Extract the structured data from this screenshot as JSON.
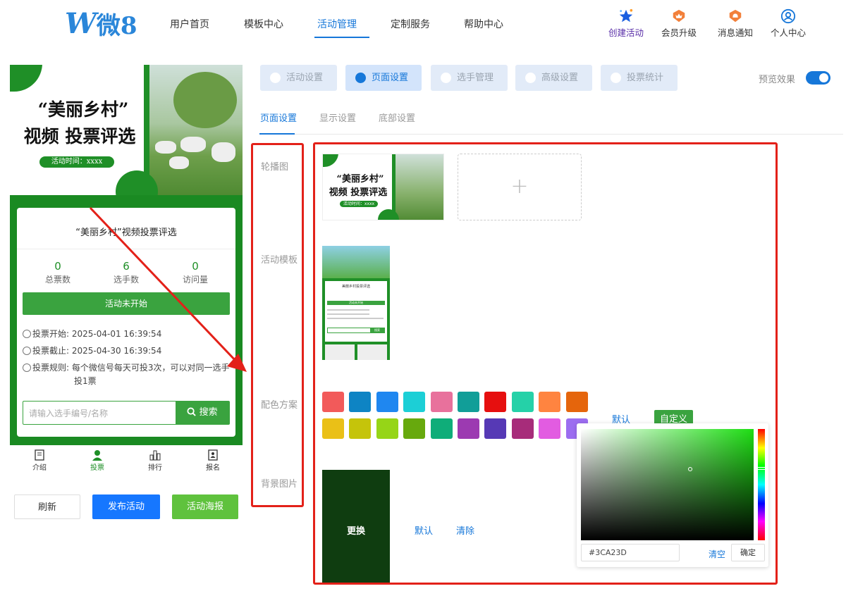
{
  "header": {
    "logo_letter": "W",
    "logo_text": "微8",
    "nav": [
      "用户首页",
      "模板中心",
      "活动管理",
      "定制服务",
      "帮助中心"
    ],
    "active_nav": "活动管理",
    "actions": [
      {
        "label": "创建活动",
        "icon": "star-icon"
      },
      {
        "label": "会员升级",
        "icon": "crown-badge-icon"
      },
      {
        "label": "消息通知",
        "icon": "bell-badge-icon"
      },
      {
        "label": "个人中心",
        "icon": "user-icon"
      }
    ],
    "accent": "#1677d9"
  },
  "preview": {
    "banner_title_line1": "“美丽乡村”",
    "banner_title_line2": "视频 投票评选",
    "banner_time": "活动时间：xxxx",
    "card_title": "“美丽乡村”视频投票评选",
    "stats": [
      {
        "value": "0",
        "label": "总票数"
      },
      {
        "value": "6",
        "label": "选手数"
      },
      {
        "value": "0",
        "label": "访问量"
      }
    ],
    "status_button": "活动未开始",
    "vote_start_label": "投票开始:",
    "vote_start": "2025-04-01 16:39:54",
    "vote_end_label": "投票截止:",
    "vote_end": "2025-04-30 16:39:54",
    "rule_label": "投票规则:",
    "rule_text_line1": "每个微信号每天可投3次，可以对同一选手",
    "rule_text_line2": "投1票",
    "search_placeholder": "请输入选手编号/名称",
    "search_button": "搜索",
    "tabs": [
      {
        "label": "介绍",
        "icon": "document-icon"
      },
      {
        "label": "投票",
        "icon": "person-icon"
      },
      {
        "label": "排行",
        "icon": "bar-chart-icon"
      },
      {
        "label": "报名",
        "icon": "signup-icon"
      }
    ],
    "active_tab": "投票",
    "theme_green": "#1f8f27"
  },
  "actions": {
    "refresh": "刷新",
    "publish": "发布活动",
    "poster": "活动海报"
  },
  "settings": {
    "tabs": [
      {
        "label": "活动设置",
        "icon": "heart-icon"
      },
      {
        "label": "页面设置",
        "icon": "layout-icon"
      },
      {
        "label": "选手管理",
        "icon": "user-icon"
      },
      {
        "label": "高级设置",
        "icon": "settings-icon"
      },
      {
        "label": "投票统计",
        "icon": "stats-icon"
      }
    ],
    "active_tab": "页面设置",
    "preview_label": "预览效果",
    "preview_on": true,
    "subtabs": [
      "页面设置",
      "显示设置",
      "底部设置"
    ],
    "active_subtab": "页面设置",
    "fields": {
      "carousel": "轮播图",
      "template": "活动模板",
      "color_scheme": "配色方案",
      "background": "背景图片"
    },
    "add_symbol": "+",
    "color_row1": [
      "#f25a5a",
      "#0e84c4",
      "#1f87f0",
      "#1ccfd6",
      "#e8719c",
      "#119e98",
      "#e60f0f",
      "#25d1a8",
      "#ff8440",
      "#e5650c"
    ],
    "color_row2": [
      "#eac017",
      "#c5c40a",
      "#96d517",
      "#67a90d",
      "#0fad79",
      "#9c3ab1",
      "#5639b5",
      "#a72c7a",
      "#e25ce1",
      "#9c6df0"
    ],
    "color_default": "默认",
    "color_custom": "自定义",
    "bg_change": "更换",
    "bg_default": "默认",
    "bg_clear": "清除",
    "picker": {
      "hex": "#3CA23D",
      "clear": "清空",
      "confirm": "确定"
    },
    "template_mini": {
      "title": "美丽乡村投票评选",
      "button": "活动未开始",
      "search": "搜索"
    }
  }
}
